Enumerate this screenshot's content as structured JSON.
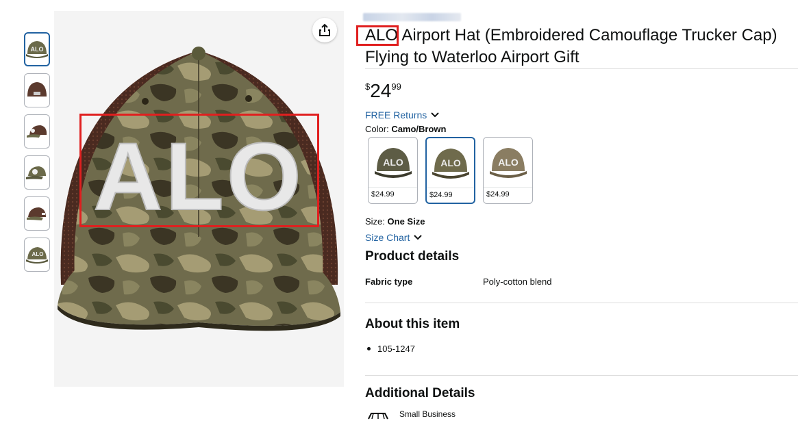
{
  "product": {
    "title": "Airport Hat (Embroidered Camouflage Trucker Cap) Flying to Waterloo Airport Gift",
    "title_code": "ALO",
    "embroidery_text": "ALO",
    "price": {
      "currency_symbol": "$",
      "whole": "24",
      "fraction": "99"
    },
    "free_returns": "FREE Returns",
    "color": {
      "label": "Color:",
      "value": "Camo/Brown"
    },
    "swatches": [
      {
        "price": "$24.99",
        "selected": false
      },
      {
        "price": "$24.99",
        "selected": true
      },
      {
        "price": "$24.99",
        "selected": false
      }
    ],
    "size": {
      "label": "Size:",
      "value": "One Size"
    },
    "size_chart": "Size Chart"
  },
  "sections": {
    "product_details": {
      "heading": "Product details",
      "rows": [
        {
          "key": "Fabric type",
          "value": "Poly-cotton blend"
        }
      ]
    },
    "about": {
      "heading": "About this item",
      "bullets": [
        "105-1247"
      ]
    },
    "additional": {
      "heading": "Additional Details",
      "small_business": "Small Business"
    }
  },
  "thumbnails": [
    {
      "view": "front",
      "selected": true
    },
    {
      "view": "back",
      "selected": false
    },
    {
      "view": "side",
      "selected": false
    },
    {
      "view": "side-left",
      "selected": false
    },
    {
      "view": "side-right",
      "selected": false
    },
    {
      "view": "angle",
      "selected": false
    }
  ],
  "icons": {
    "share": "share-icon",
    "chevron": "chevron-down-icon",
    "store": "store-icon"
  },
  "colors": {
    "link": "#2162a1",
    "highlight": "#e01f1f",
    "text": "#0f1111",
    "selected_border": "#2162a1"
  }
}
